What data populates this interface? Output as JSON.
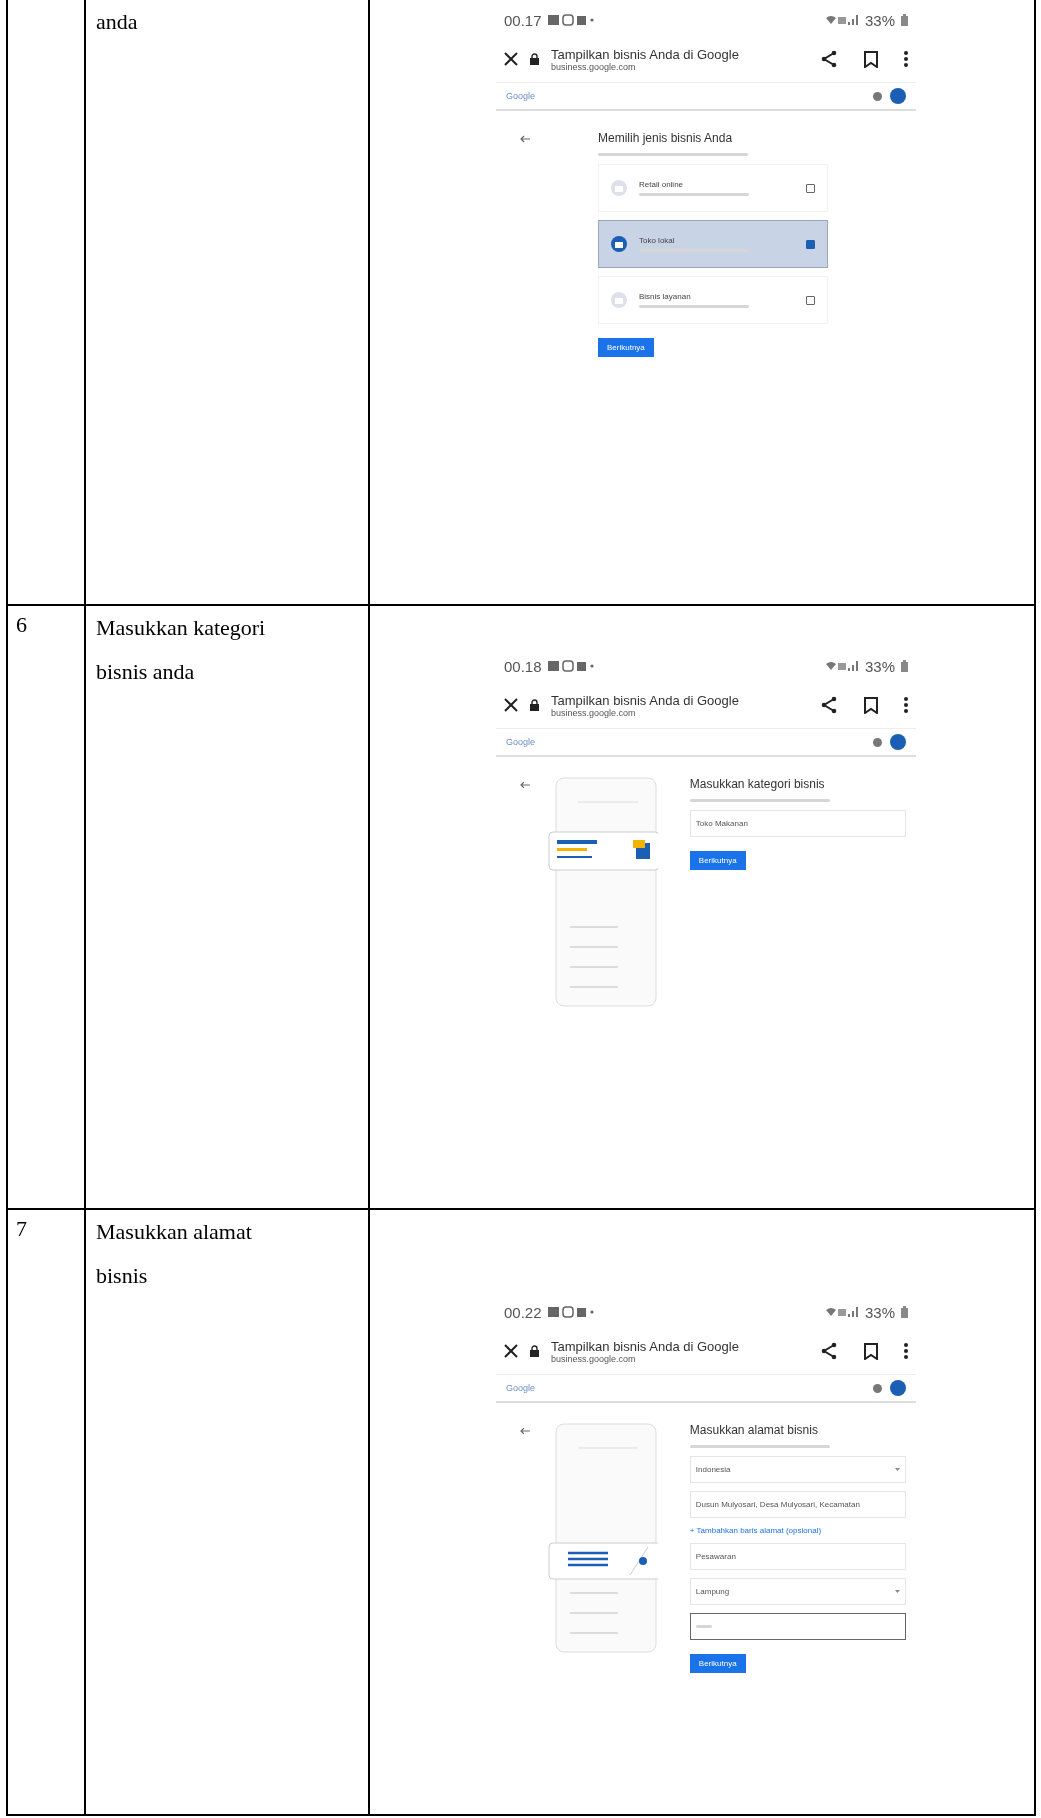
{
  "rows": [
    {
      "step": "anda",
      "screen": {
        "kind": "business_type",
        "time": "00.17",
        "battery": "33%",
        "page_title": "Tampilkan bisnis Anda di Google",
        "url": "business.google.com",
        "brand": "Google",
        "heading": "Memilih jenis bisnis Anda",
        "options": [
          {
            "title": "Retail online",
            "selected": false
          },
          {
            "title": "Toko lokal",
            "selected": true
          },
          {
            "title": "Bisnis layanan",
            "selected": false
          }
        ],
        "button": "Berikutnya"
      }
    },
    {
      "number": "6",
      "step": "Masukkan kategori bisnis anda",
      "screen": {
        "kind": "category",
        "time": "00.18",
        "battery": "33%",
        "page_title": "Tampilkan bisnis Anda di Google",
        "url": "business.google.com",
        "brand": "Google",
        "heading": "Masukkan kategori bisnis",
        "fields": [
          {
            "value": "Toko Makanan",
            "dropdown": false,
            "focused": false
          }
        ],
        "button": "Berikutnya"
      }
    },
    {
      "number": "7",
      "step": "Masukkan alamat bisnis",
      "screen": {
        "kind": "address",
        "time": "00.22",
        "battery": "33%",
        "page_title": "Tampilkan bisnis Anda di Google",
        "url": "business.google.com",
        "brand": "Google",
        "heading": "Masukkan alamat bisnis",
        "fields": [
          {
            "value": "Indonesia",
            "dropdown": true,
            "focused": false
          },
          {
            "value": "Dusun Mulyosari, Desa Mulyosari, Kecamatan",
            "dropdown": false,
            "focused": false
          },
          {
            "value": "Pesawaran",
            "dropdown": false,
            "focused": false
          },
          {
            "value": "Lampung",
            "dropdown": true,
            "focused": false
          },
          {
            "dropdown": false,
            "focused": true
          }
        ],
        "link": "+ Tambahkan baris alamat (opsional)",
        "button": "Berikutnya"
      }
    }
  ]
}
